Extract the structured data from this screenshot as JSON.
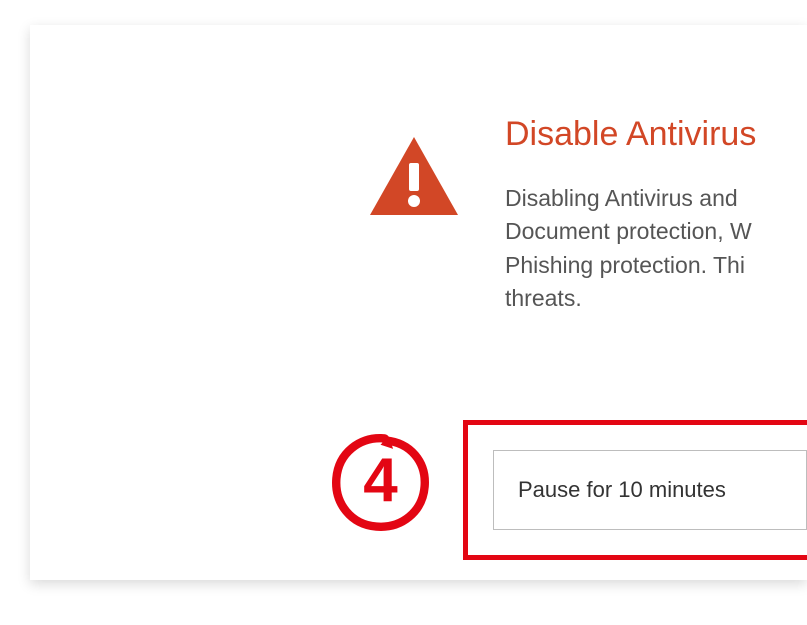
{
  "dialog": {
    "title": "Disable Antivirus",
    "body": "Disabling Antivirus and\nDocument protection, W\nPhishing protection. Thi\nthreats.",
    "dropdown_value": "Pause for 10 minutes"
  },
  "annotation": {
    "step_number": "4"
  },
  "icons": {
    "warning": "warning-triangle"
  },
  "colors": {
    "accent": "#d24726",
    "annotation": "#e30613"
  }
}
